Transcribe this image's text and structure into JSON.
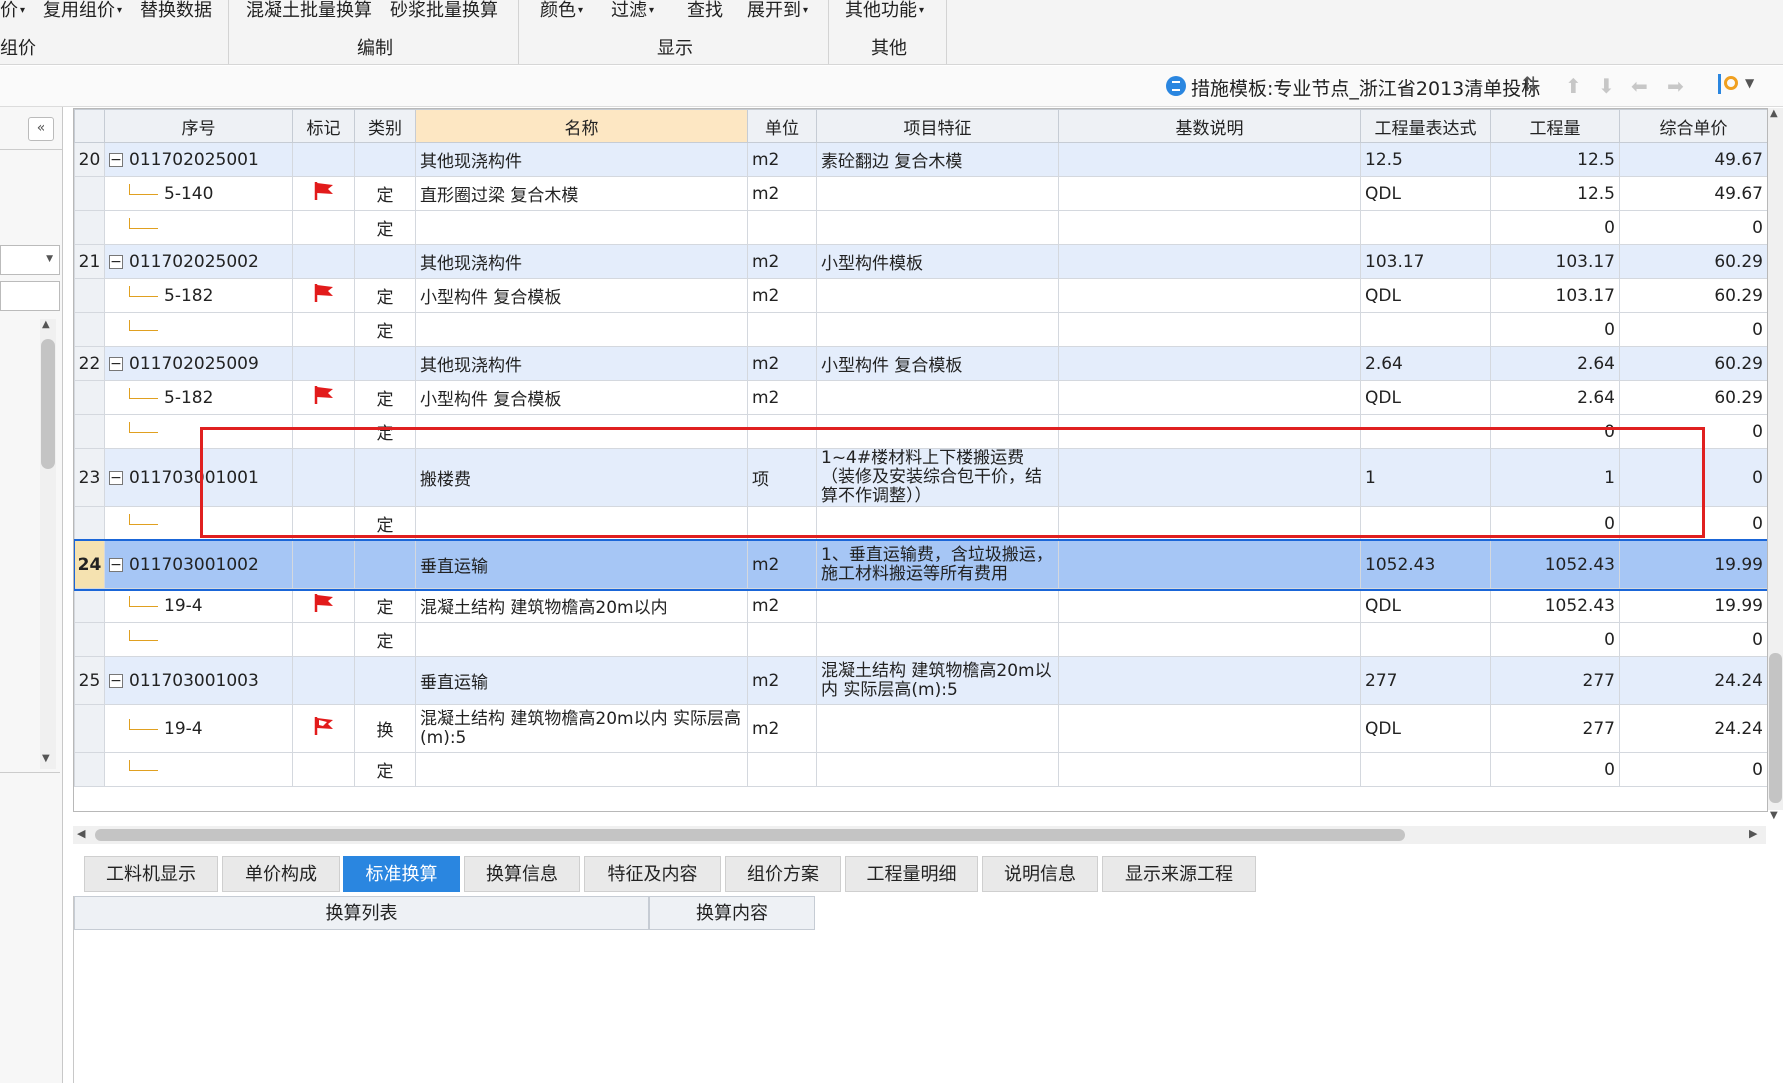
{
  "ribbon": {
    "items": [
      {
        "label": "价",
        "caret": true
      },
      {
        "label": "复用组价",
        "caret": true
      },
      {
        "label": "替换数据",
        "caret": false
      },
      {
        "label": "混凝土批量换算",
        "caret": false
      },
      {
        "label": "砂浆批量换算",
        "caret": false
      },
      {
        "label": "颜色",
        "caret": true
      },
      {
        "label": "过滤",
        "caret": true
      },
      {
        "label": "查找",
        "caret": false
      },
      {
        "label": "展开到",
        "caret": true
      },
      {
        "label": "其他功能",
        "caret": true
      }
    ],
    "groups": [
      "组价",
      "编制",
      "显示",
      "其他"
    ]
  },
  "template_bar": {
    "label": "措施模板:专业节点_浙江省2013清单投标"
  },
  "columns": [
    "序号",
    "标记",
    "类别",
    "名称",
    "单位",
    "项目特征",
    "基数说明",
    "工程量表达式",
    "工程量",
    "综合单价"
  ],
  "rows": [
    {
      "kind": "bill",
      "idx": "20",
      "code": "011702025001",
      "flag": "",
      "type": "",
      "name": "其他现浇构件",
      "unit": "m2",
      "feature": "素砼翻边 复合木模",
      "basis": "",
      "expr": "12.5",
      "qty": "12.5",
      "price": "49.67"
    },
    {
      "kind": "quota",
      "idx": "",
      "code": "5-140",
      "flag": "red",
      "type": "定",
      "name": "直形圈过梁 复合木模",
      "unit": "m2",
      "feature": "",
      "basis": "",
      "expr": "QDL",
      "qty": "12.5",
      "price": "49.67"
    },
    {
      "kind": "empty",
      "idx": "",
      "code": "",
      "flag": "",
      "type": "定",
      "name": "",
      "unit": "",
      "feature": "",
      "basis": "",
      "expr": "",
      "qty": "0",
      "price": "0"
    },
    {
      "kind": "bill",
      "idx": "21",
      "code": "011702025002",
      "flag": "",
      "type": "",
      "name": "其他现浇构件",
      "unit": "m2",
      "feature": "小型构件模板",
      "basis": "",
      "expr": "103.17",
      "qty": "103.17",
      "price": "60.29"
    },
    {
      "kind": "quota",
      "idx": "",
      "code": "5-182",
      "flag": "red",
      "type": "定",
      "name": "小型构件 复合模板",
      "unit": "m2",
      "feature": "",
      "basis": "",
      "expr": "QDL",
      "qty": "103.17",
      "price": "60.29"
    },
    {
      "kind": "empty",
      "idx": "",
      "code": "",
      "flag": "",
      "type": "定",
      "name": "",
      "unit": "",
      "feature": "",
      "basis": "",
      "expr": "",
      "qty": "0",
      "price": "0"
    },
    {
      "kind": "bill",
      "idx": "22",
      "code": "011702025009",
      "flag": "",
      "type": "",
      "name": "其他现浇构件",
      "unit": "m2",
      "feature": "小型构件 复合模板",
      "basis": "",
      "expr": "2.64",
      "qty": "2.64",
      "price": "60.29"
    },
    {
      "kind": "quota",
      "idx": "",
      "code": "5-182",
      "flag": "red",
      "type": "定",
      "name": "小型构件 复合模板",
      "unit": "m2",
      "feature": "",
      "basis": "",
      "expr": "QDL",
      "qty": "2.64",
      "price": "60.29"
    },
    {
      "kind": "empty",
      "idx": "",
      "code": "",
      "flag": "",
      "type": "定",
      "name": "",
      "unit": "",
      "feature": "",
      "basis": "",
      "expr": "",
      "qty": "0",
      "price": "0"
    },
    {
      "kind": "bill",
      "tall": true,
      "idx": "23",
      "code": "011703001001",
      "flag": "",
      "type": "",
      "name": "搬楼费",
      "unit": "项",
      "feature": "1~4#楼材料上下楼搬运费（装修及安装综合包干价，结算不作调整））",
      "basis": "",
      "expr": "1",
      "qty": "1",
      "price": "0"
    },
    {
      "kind": "empty",
      "idx": "",
      "code": "",
      "flag": "",
      "type": "定",
      "name": "",
      "unit": "",
      "feature": "",
      "basis": "",
      "expr": "",
      "qty": "0",
      "price": "0"
    },
    {
      "kind": "sel",
      "idx": "24",
      "code": "011703001002",
      "flag": "",
      "type": "",
      "name": "垂直运输",
      "unit": "m2",
      "feature": "1、垂直运输费，含垃圾搬运，施工材料搬运等所有费用",
      "basis": "",
      "expr": "1052.43",
      "qty": "1052.43",
      "price": "19.99"
    },
    {
      "kind": "quota",
      "idx": "",
      "code": "19-4",
      "flag": "red",
      "type": "定",
      "name": "混凝土结构 建筑物檐高20m以内",
      "unit": "m2",
      "feature": "",
      "basis": "",
      "expr": "QDL",
      "qty": "1052.43",
      "price": "19.99"
    },
    {
      "kind": "empty",
      "idx": "",
      "code": "",
      "flag": "",
      "type": "定",
      "name": "",
      "unit": "",
      "feature": "",
      "basis": "",
      "expr": "",
      "qty": "0",
      "price": "0"
    },
    {
      "kind": "bill",
      "idx": "25",
      "code": "011703001003",
      "flag": "",
      "type": "",
      "name": "垂直运输",
      "unit": "m2",
      "feature": "混凝土结构 建筑物檐高20m以内 实际层高(m):5",
      "basis": "",
      "expr": "277",
      "qty": "277",
      "price": "24.24"
    },
    {
      "kind": "quota",
      "idx": "",
      "code": "19-4",
      "flag": "redwhite",
      "type": "换",
      "name": "混凝土结构 建筑物檐高20m以内 实际层高(m):5",
      "unit": "m2",
      "feature": "",
      "basis": "",
      "expr": "QDL",
      "qty": "277",
      "price": "24.24"
    },
    {
      "kind": "empty",
      "idx": "",
      "code": "",
      "flag": "",
      "type": "定",
      "name": "",
      "unit": "",
      "feature": "",
      "basis": "",
      "expr": "",
      "qty": "0",
      "price": "0"
    }
  ],
  "tabs": [
    "工料机显示",
    "单价构成",
    "标准换算",
    "换算信息",
    "特征及内容",
    "组价方案",
    "工程量明细",
    "说明信息",
    "显示来源工程"
  ],
  "active_tab": 2,
  "bottom_headers": [
    "换算列表",
    "换算内容"
  ],
  "colors": {
    "accent": "#2a86e0",
    "selection": "#a6c6f5",
    "annotation": "#e02020",
    "flag": "#e21b1b"
  }
}
